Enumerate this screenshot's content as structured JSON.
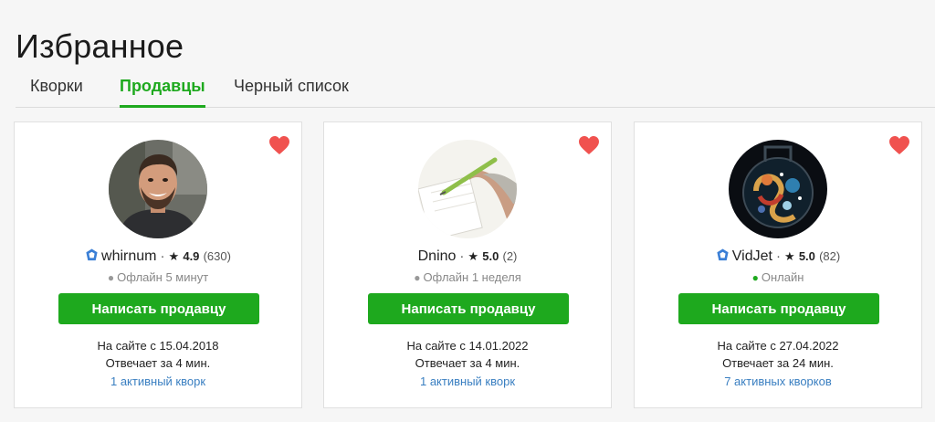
{
  "page": {
    "title": "Избранное"
  },
  "tabs": [
    {
      "label": "Кворки",
      "active": false
    },
    {
      "label": "Продавцы",
      "active": true
    },
    {
      "label": "Черный список",
      "active": false
    }
  ],
  "colors": {
    "accent": "#1ea91e",
    "heart": "#f0524f",
    "link": "#3a7fc1",
    "online": "#1ea91e",
    "offline": "#999999"
  },
  "sellers": [
    {
      "name": "whirnum",
      "verified": true,
      "rating": "4.9",
      "reviews": "(630)",
      "status": "Офлайн 5 минут",
      "online": false,
      "button": "Написать продавцу",
      "since": "На сайте с 15.04.2018",
      "response": "Отвечает за 4 мин.",
      "active": "1 активный кворк"
    },
    {
      "name": "Dnino",
      "verified": false,
      "rating": "5.0",
      "reviews": "(2)",
      "status": "Офлайн 1 неделя",
      "online": false,
      "button": "Написать продавцу",
      "since": "На сайте с 14.01.2022",
      "response": "Отвечает за 4 мин.",
      "active": "1 активный кворк"
    },
    {
      "name": "VidJet",
      "verified": true,
      "rating": "5.0",
      "reviews": "(82)",
      "status": "Онлайн",
      "online": true,
      "button": "Написать продавцу",
      "since": "На сайте с 27.04.2022",
      "response": "Отвечает за 24 мин.",
      "active": "7 активных кворков"
    }
  ],
  "icons": {
    "favorite": "heart-icon",
    "verified": "verified-badge-icon",
    "rating": "star-icon"
  }
}
